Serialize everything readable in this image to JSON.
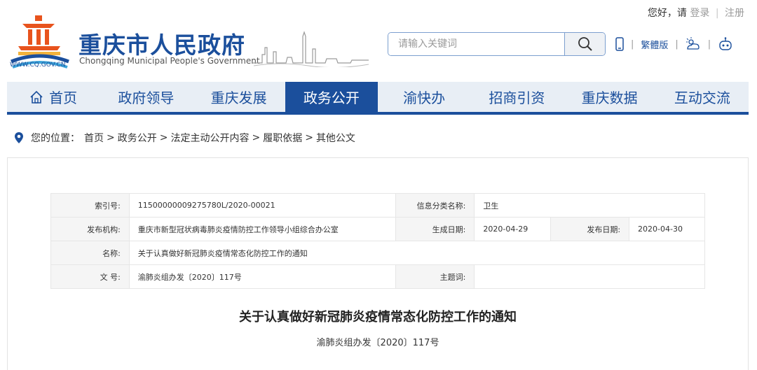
{
  "top": {
    "greeting": "您好，请",
    "login": "登录",
    "sep": "|",
    "register": "注册"
  },
  "logo": {
    "name": "重庆市人民政府",
    "en": "Chongqing Municipal People's Government",
    "url": "WWW.CQ.GOV.CN",
    "brand_color": "#1b4f9c",
    "emblem_color": "#e8531d"
  },
  "search": {
    "placeholder": "请输入关键词",
    "value": ""
  },
  "tools": {
    "mobile_icon": "mobile-icon",
    "traditional": "繁體版",
    "weather_icon": "weather-icon",
    "robot_icon": "robot-icon"
  },
  "nav": {
    "items": [
      {
        "label": "首页",
        "icon": "home-icon"
      },
      {
        "label": "政府领导"
      },
      {
        "label": "重庆发展"
      },
      {
        "label": "政务公开",
        "active": true
      },
      {
        "label": "渝快办"
      },
      {
        "label": "招商引资"
      },
      {
        "label": "重庆数据"
      },
      {
        "label": "互动交流"
      }
    ]
  },
  "breadcrumb": {
    "prefix": "您的位置：",
    "items": [
      "首页",
      "政务公开",
      "法定主动公开内容",
      "履职依据",
      "其他公文"
    ],
    "sep": ">"
  },
  "meta": {
    "index_label": "索引号:",
    "index_value": "11500000009275780L/2020-00021",
    "category_label": "信息分类名称:",
    "category_value": "卫生",
    "org_label": "发布机构:",
    "org_value": "重庆市新型冠状病毒肺炎疫情防控工作领导小组综合办公室",
    "created_label": "生成日期:",
    "created_value": "2020-04-29",
    "published_label": "发布日期:",
    "published_value": "2020-04-30",
    "name_label": "名称:",
    "name_value": "关于认真做好新冠肺炎疫情常态化防控工作的通知",
    "docno_label": "文 号:",
    "docno_value": "渝肺炎组办发〔2020〕117号",
    "subject_label": "主题词:",
    "subject_value": ""
  },
  "document": {
    "title": "关于认真做好新冠肺炎疫情常态化防控工作的通知",
    "number": "渝肺炎组办发〔2020〕117号"
  }
}
